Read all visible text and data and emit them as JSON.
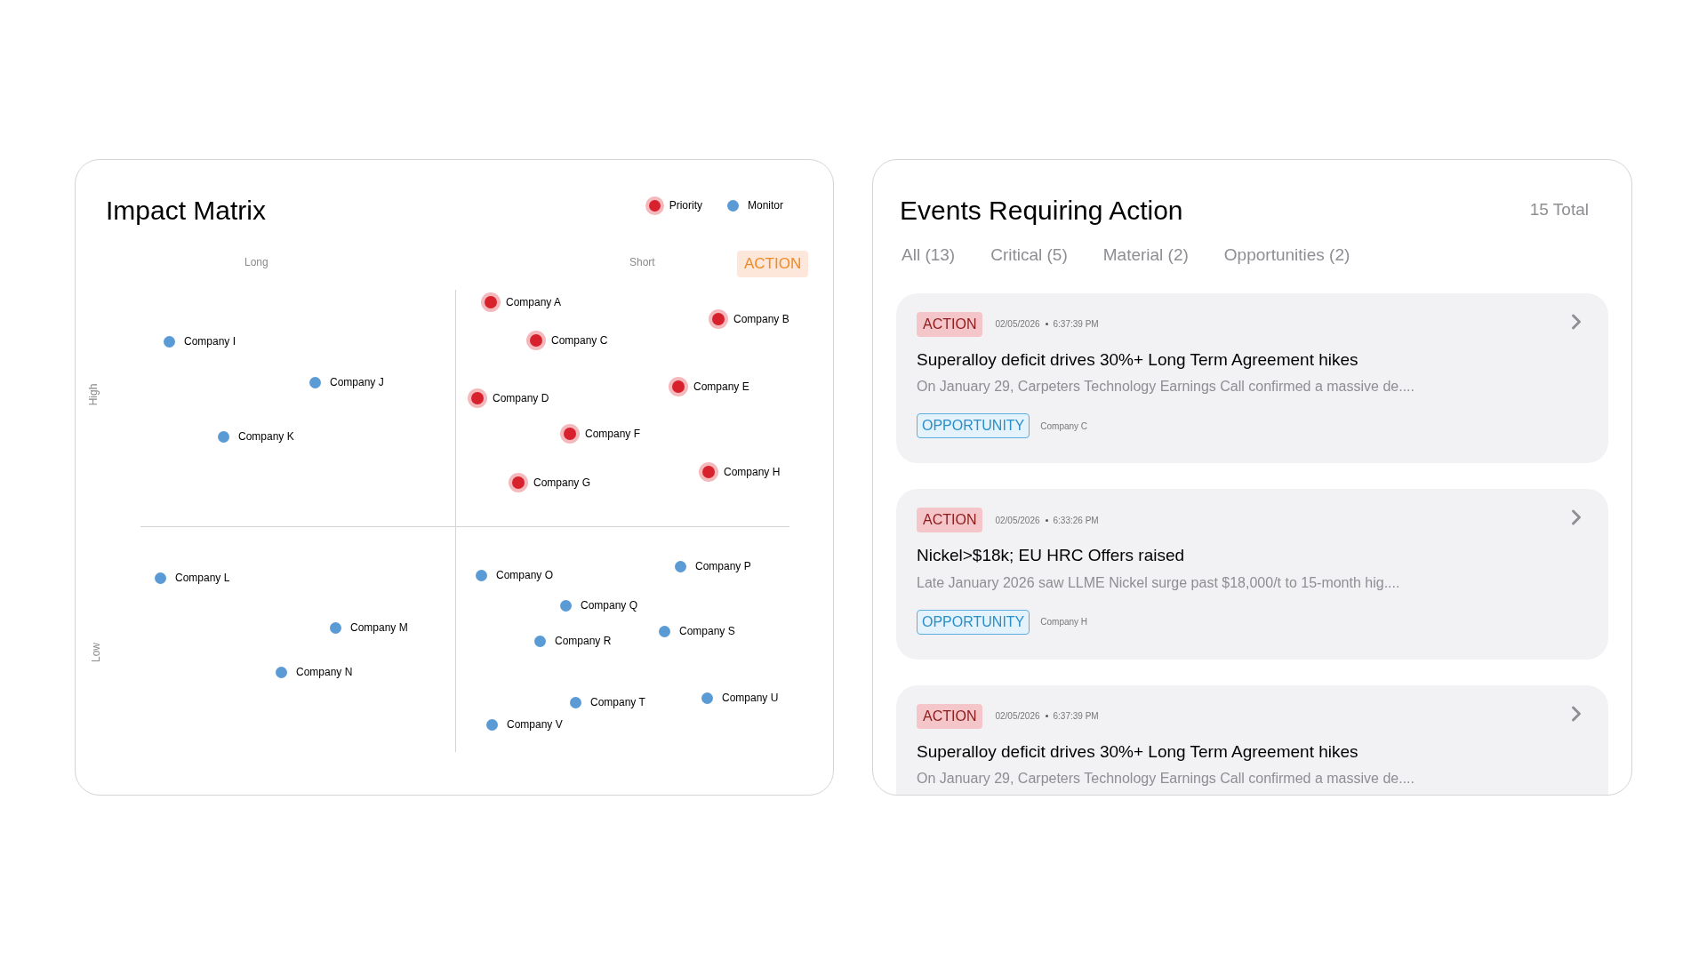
{
  "matrix": {
    "title": "Impact Matrix",
    "legend": [
      {
        "label": "Priority",
        "kind": "priority",
        "color": "#d7212c"
      },
      {
        "label": "Monitor",
        "kind": "monitor",
        "color": "#5b9bd5"
      }
    ],
    "x_labels": [
      "Long",
      "Short"
    ],
    "y_labels": [
      "High",
      "Low"
    ],
    "badge": "ACTION",
    "points": [
      {
        "label": "Company A",
        "kind": "priority"
      },
      {
        "label": "Company B",
        "kind": "priority"
      },
      {
        "label": "Company C",
        "kind": "priority"
      },
      {
        "label": "Company D",
        "kind": "priority"
      },
      {
        "label": "Company E",
        "kind": "priority"
      },
      {
        "label": "Company F",
        "kind": "priority"
      },
      {
        "label": "Company G",
        "kind": "priority"
      },
      {
        "label": "Company H",
        "kind": "priority"
      },
      {
        "label": "Company I",
        "kind": "monitor"
      },
      {
        "label": "Company J",
        "kind": "monitor"
      },
      {
        "label": "Company K",
        "kind": "monitor"
      },
      {
        "label": "Company L",
        "kind": "monitor"
      },
      {
        "label": "Company M",
        "kind": "monitor"
      },
      {
        "label": "Company N",
        "kind": "monitor"
      },
      {
        "label": "Company O",
        "kind": "monitor"
      },
      {
        "label": "Company P",
        "kind": "monitor"
      },
      {
        "label": "Company Q",
        "kind": "monitor"
      },
      {
        "label": "Company R",
        "kind": "monitor"
      },
      {
        "label": "Company S",
        "kind": "monitor"
      },
      {
        "label": "Company T",
        "kind": "monitor"
      },
      {
        "label": "Company U",
        "kind": "monitor"
      },
      {
        "label": "Company V",
        "kind": "monitor"
      }
    ]
  },
  "events": {
    "title": "Events Requiring Action",
    "total": "15 Total",
    "tabs": [
      {
        "label": "All (13)",
        "selected": false
      },
      {
        "label": "Critical (5)",
        "selected": false
      },
      {
        "label": "Material (2)",
        "selected": false
      },
      {
        "label": "Opportunities (2)",
        "selected": false
      }
    ],
    "items": [
      {
        "badge": "ACTION",
        "date": "02/05/2026",
        "time": "6:37:39 PM",
        "title": "Superalloy deficit drives 30%+ Long Term Agreement hikes",
        "summary": "On January 29, Carpeters Technology Earnings Call confirmed a massive de....",
        "tag": "OPPORTUNITY",
        "company": "Company C"
      },
      {
        "badge": "ACTION",
        "date": "02/05/2026",
        "time": "6:33:26 PM",
        "title": "Nickel>$18k; EU HRC Offers raised",
        "summary": "Late January 2026 saw LLME Nickel surge past $18,000/t to 15-month hig....",
        "tag": "OPPORTUNITY",
        "company": "Company H"
      },
      {
        "badge": "ACTION",
        "date": "02/05/2026",
        "time": "6:37:39 PM",
        "title": "Superalloy deficit drives 30%+ Long Term Agreement hikes",
        "summary": "On January 29, Carpeters Technology Earnings Call confirmed a massive de...."
      }
    ]
  }
}
